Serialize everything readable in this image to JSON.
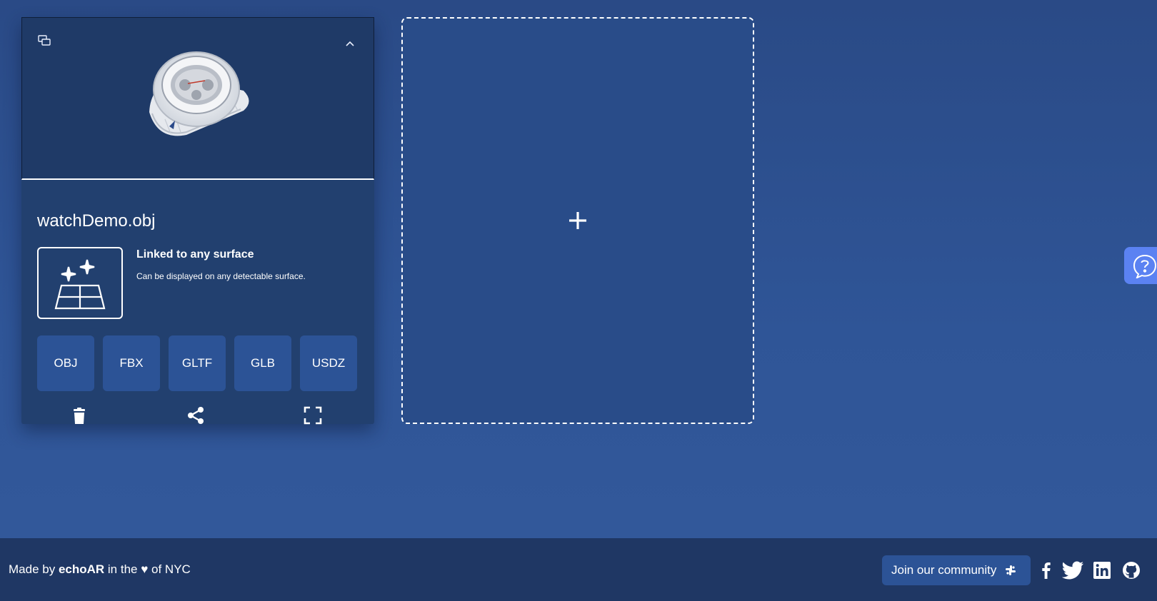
{
  "asset": {
    "file_name": "watchDemo.obj",
    "anchor_title": "Linked to any surface",
    "anchor_description": "Can be displayed on any detectable surface.",
    "formats": [
      "OBJ",
      "FBX",
      "GLTF",
      "GLB",
      "USDZ"
    ]
  },
  "footer": {
    "made_by_prefix": "Made by ",
    "brand": "echoAR",
    "made_by_middle": " in the ",
    "heart": "♥",
    "made_by_suffix": " of NYC",
    "community_label": "Join our community"
  },
  "icons": {
    "preview_toggle": "chat-bubbles-icon",
    "collapse": "chevron-up-icon",
    "anchor": "surface-sparkle-icon",
    "delete": "trash-icon",
    "share": "share-icon",
    "expand": "fullscreen-icon",
    "add": "plus-icon",
    "help": "help-chat-icon",
    "community": "slack-icon",
    "social": [
      "facebook-icon",
      "twitter-icon",
      "linkedin-icon",
      "github-icon"
    ]
  },
  "colors": {
    "background": "#2f5597",
    "card": "#22406f",
    "button": "#2c5396",
    "footer": "#1f3764",
    "help_tab": "#5b82f2"
  }
}
